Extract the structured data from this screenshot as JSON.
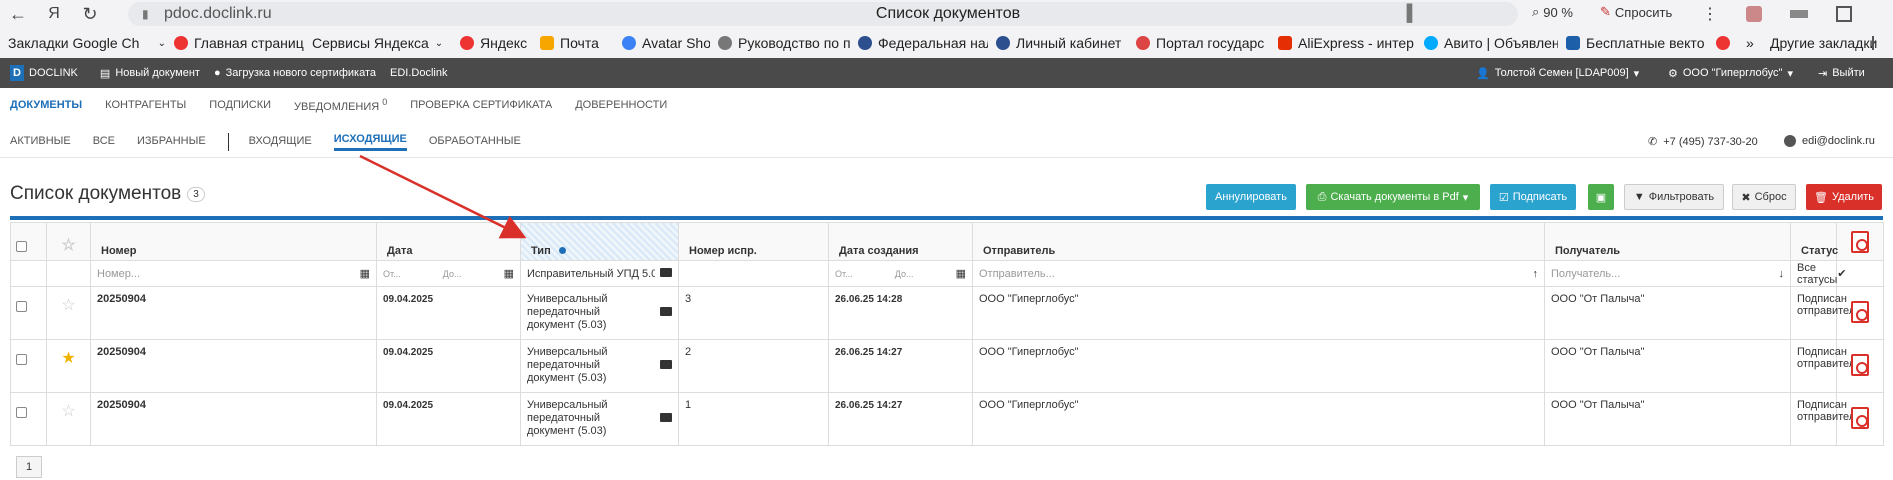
{
  "browser": {
    "back_icon": "arrow-left-icon",
    "url": "pdoc.doclink.ru",
    "page_title": "Список документов",
    "zoom": "90 %",
    "ask_label": "Спросить"
  },
  "bookmarks": {
    "items": [
      "Закладки Google Ch",
      "Главная страница",
      "Сервисы Яндекса",
      "Яндекс",
      "Почта",
      "Avatar Shop",
      "Руководство по п",
      "Федеральная нал",
      "Личный кабинет",
      "Портал государс",
      "AliExpress - интер",
      "Авито | Объявлен",
      "Бесплатные векто"
    ],
    "more": "»",
    "other": "Другие закладки"
  },
  "appbar": {
    "logo": "D",
    "brand": "DOCLINK",
    "new_doc": "Новый документ",
    "load_cert": "Загрузка нового сертификата",
    "edi": "EDI.Doclink",
    "user": "Толстой Семен [LDAP009]",
    "org": "ООО \"Гиперглобус\"",
    "logout": "Выйти"
  },
  "mainnav": {
    "items": [
      "ДОКУМЕНТЫ",
      "КОНТРАГЕНТЫ",
      "ПОДПИСКИ",
      "УВЕДОМЛЕНИЯ",
      "ПРОВЕРКА СЕРТИФИКАТА",
      "ДОВЕРЕННОСТИ"
    ],
    "notif_count": "0"
  },
  "subnav": {
    "items": [
      "АКТИВНЫЕ",
      "ВСЕ",
      "ИЗБРАННЫЕ",
      "ВХОДЯЩИЕ",
      "ИСХОДЯЩИЕ",
      "ОБРАБОТАННЫЕ"
    ],
    "active": "ИСХОДЯЩИЕ",
    "phone": "+7 (495) 737-30-20",
    "email": "edi@doclink.ru"
  },
  "page": {
    "title": "Список документов",
    "count": "3"
  },
  "toolbar": {
    "annul": "Аннулировать",
    "download_pdf": "Скачать документы в Pdf",
    "sign": "Подписать",
    "filter": "Фильтровать",
    "reset": "Сброс",
    "delete": "Удалить"
  },
  "table": {
    "headers": [
      "Номер",
      "Дата",
      "Тип",
      "Номер испр.",
      "Дата создания",
      "Отправитель",
      "Получатель",
      "Статус"
    ],
    "filters": {
      "number": "Номер...",
      "date_from": "От...",
      "date_to": "До...",
      "type": "Исправительный УПД 5.0",
      "created_from": "От...",
      "created_to": "До...",
      "sender": "Отправитель...",
      "recipient": "Получатель...",
      "status": "Все статусы"
    },
    "rows": [
      {
        "number": "20250904",
        "date": "09.04.2025",
        "type": "Универсальный передаточный документ (5.03)",
        "corr": "3",
        "created": "26.06.25 14:28",
        "sender": "ООО \"Гиперглобус\"",
        "recipient": "ООО \"От Палыча\"",
        "status": "Подписан отправителем",
        "starred": false
      },
      {
        "number": "20250904",
        "date": "09.04.2025",
        "type": "Универсальный передаточный документ (5.03)",
        "corr": "2",
        "created": "26.06.25 14:27",
        "sender": "ООО \"Гиперглобус\"",
        "recipient": "ООО \"От Палыча\"",
        "status": "Подписан отправителем",
        "starred": true
      },
      {
        "number": "20250904",
        "date": "09.04.2025",
        "type": "Универсальный передаточный документ (5.03)",
        "corr": "1",
        "created": "26.06.25 14:27",
        "sender": "ООО \"Гиперглобус\"",
        "recipient": "ООО \"От Палыча\"",
        "status": "Подписан отправителем",
        "starred": false
      }
    ]
  },
  "pager": {
    "page": "1"
  },
  "colors": {
    "accent": "#1d6fb8",
    "annul": "#2aa3cf",
    "download": "#4cae4c",
    "sign": "#2aa3cf",
    "delete": "#d9302a",
    "arrow": "#d9302a"
  }
}
